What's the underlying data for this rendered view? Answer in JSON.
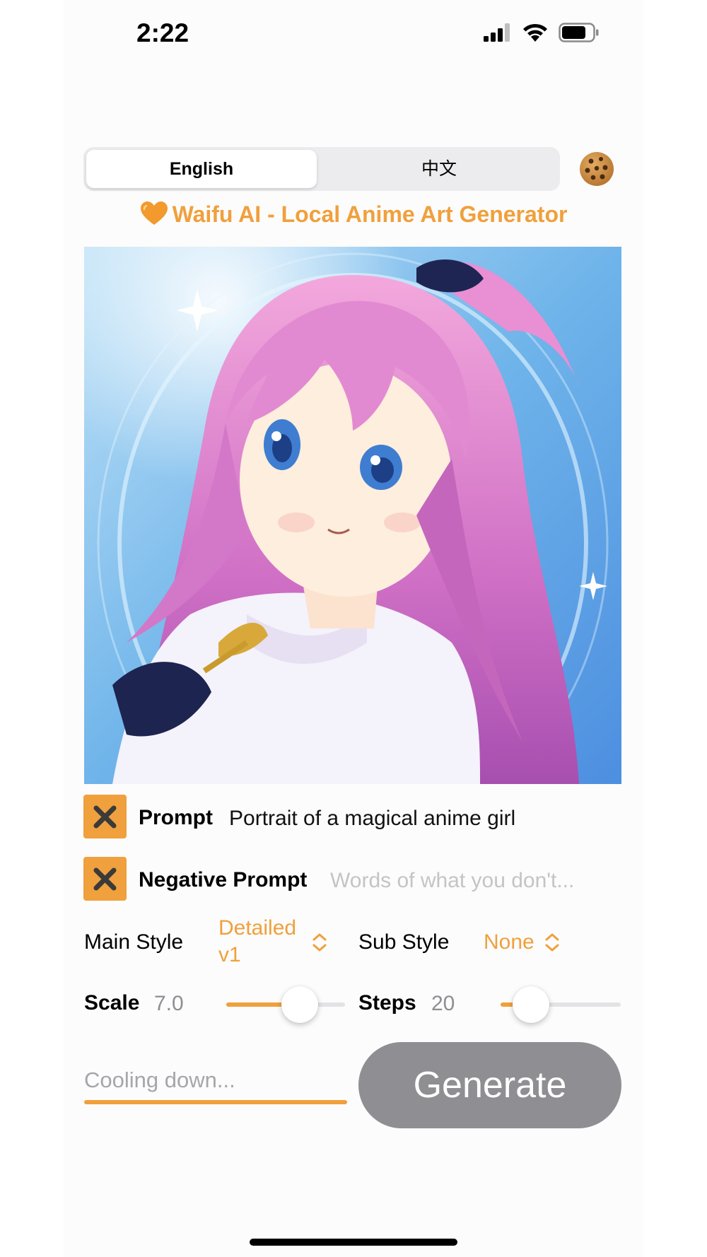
{
  "status_bar": {
    "time": "2:22"
  },
  "language": {
    "options": [
      "English",
      "中文"
    ],
    "selected": "English"
  },
  "app": {
    "title": "Waifu AI - Local Anime Art Generator"
  },
  "prompt": {
    "label": "Prompt",
    "value": "Portrait of a magical anime girl"
  },
  "negative_prompt": {
    "label": "Negative Prompt",
    "placeholder": "Words of what you don't..."
  },
  "main_style": {
    "label": "Main Style",
    "value_line1": "Detailed",
    "value_line2": "v1"
  },
  "sub_style": {
    "label": "Sub Style",
    "value": "None"
  },
  "scale": {
    "label": "Scale",
    "value": "7.0",
    "fraction": 0.62
  },
  "steps": {
    "label": "Steps",
    "value": "20",
    "fraction": 0.25
  },
  "status": {
    "text": "Cooling down..."
  },
  "generate": {
    "label": "Generate"
  },
  "colors": {
    "accent": "#f0a03c",
    "button_disabled": "#8e8e93"
  }
}
